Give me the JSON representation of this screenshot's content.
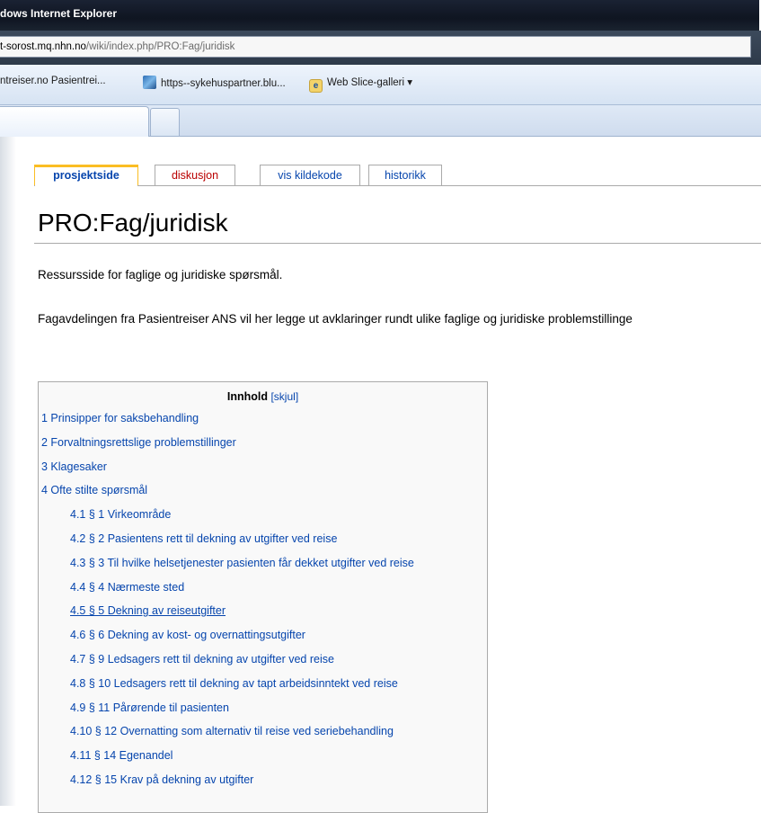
{
  "browser": {
    "title": "dows Internet Explorer",
    "address": {
      "host": "t-sorost.mq.nhn.no",
      "path": "/wiki/index.php/PRO:Fag/juridisk"
    },
    "favorites": [
      {
        "label": "ntreiser.no Pasientrei...",
        "icon": "none"
      },
      {
        "label": "https--sykehuspartner.blu...",
        "icon": "photo-icon"
      },
      {
        "label": "Web Slice-galleri ▾",
        "icon": "ie-icon"
      }
    ]
  },
  "page": {
    "tabs": [
      {
        "label": "prosjektside",
        "state": "selected"
      },
      {
        "label": "diskusjon",
        "state": "new"
      },
      {
        "label": "vis kildekode",
        "state": "normal"
      },
      {
        "label": "historikk",
        "state": "normal"
      }
    ],
    "title": "PRO:Fag/juridisk",
    "intro": "Ressursside for faglige og juridiske spørsmål.",
    "body": "Fagavdelingen fra Pasientreiser ANS vil her legge ut avklaringer rundt ulike faglige og juridiske problemstillinge",
    "toc": {
      "heading": "Innhold",
      "hide_link": "skjul",
      "items": [
        {
          "label": "1 Prinsipper for saksbehandling",
          "level": 1
        },
        {
          "label": "2 Forvaltningsrettslige problemstillinger",
          "level": 1
        },
        {
          "label": "3 Klagesaker",
          "level": 1
        },
        {
          "label": "4 Ofte stilte spørsmål",
          "level": 1
        },
        {
          "label": "4.1 § 1 Virkeområde",
          "level": 2
        },
        {
          "label": "4.2 § 2 Pasientens rett til dekning av utgifter ved reise",
          "level": 2
        },
        {
          "label": "4.3 § 3 Til hvilke helsetjenester pasienten får dekket utgifter ved reise",
          "level": 2
        },
        {
          "label": "4.4 § 4 Nærmeste sted",
          "level": 2
        },
        {
          "label": "4.5 § 5 Dekning av reiseutgifter",
          "level": 2,
          "hover": true
        },
        {
          "label": "4.6 § 6 Dekning av kost- og overnattingsutgifter",
          "level": 2
        },
        {
          "label": "4.7 § 9 Ledsagers rett til dekning av utgifter ved reise",
          "level": 2
        },
        {
          "label": "4.8 § 10 Ledsagers rett til dekning av tapt arbeidsinntekt ved reise",
          "level": 2
        },
        {
          "label": "4.9 § 11 Pårørende til pasienten",
          "level": 2
        },
        {
          "label": "4.10 § 12 Overnatting som alternativ til reise ved seriebehandling",
          "level": 2
        },
        {
          "label": "4.11 § 14 Egenandel",
          "level": 2
        },
        {
          "label": "4.12 § 15 Krav på dekning av utgifter",
          "level": 2
        }
      ]
    }
  },
  "colors": {
    "link": "#0645ad",
    "new_link": "#ba0000",
    "selected_tab_border": "#fabd23"
  }
}
